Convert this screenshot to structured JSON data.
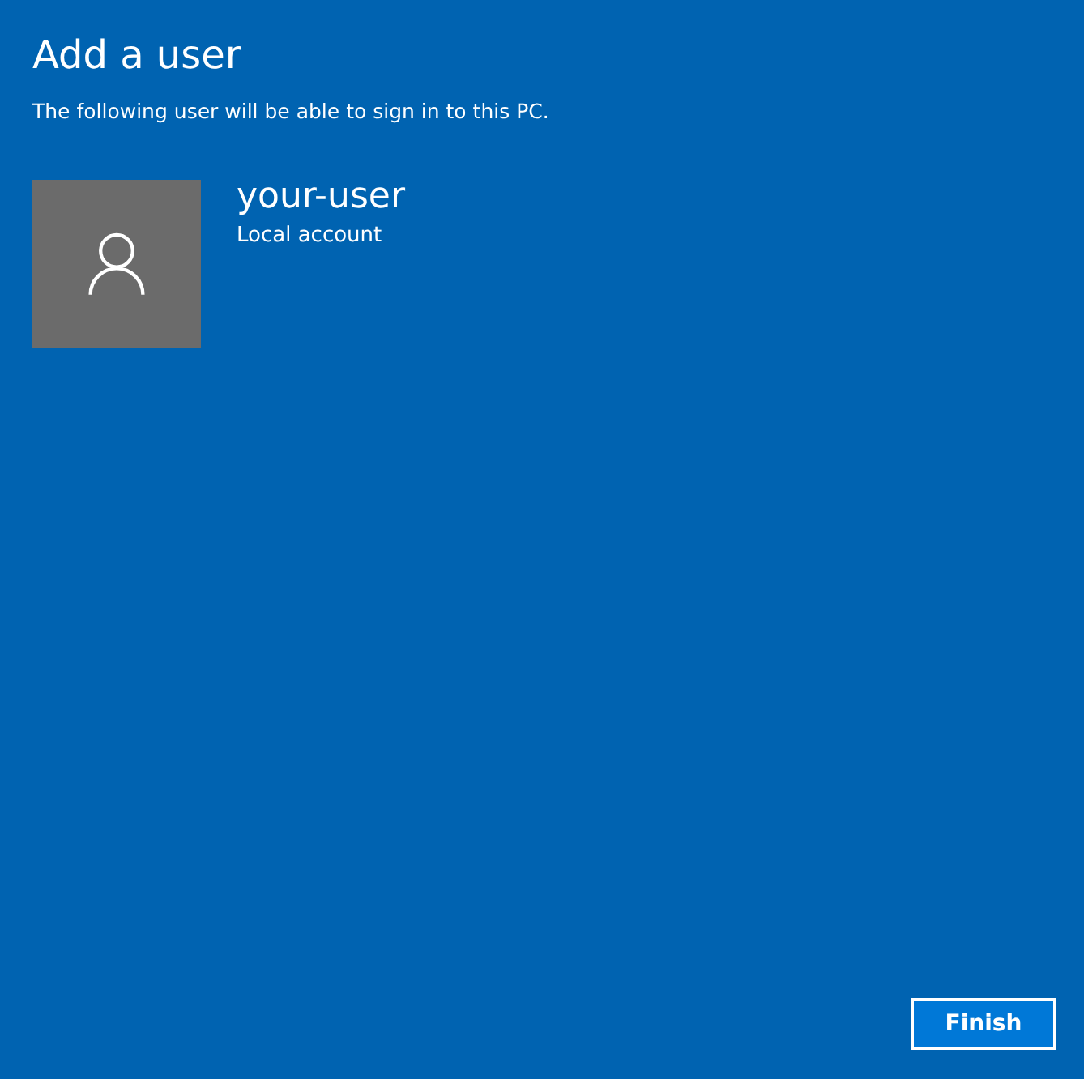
{
  "title": "Add a user",
  "description": "The following user will be able to sign in to this PC.",
  "user": {
    "name": "your-user",
    "account_type": "Local account"
  },
  "buttons": [
    {
      "label": "Finish",
      "kind": "primary"
    }
  ]
}
